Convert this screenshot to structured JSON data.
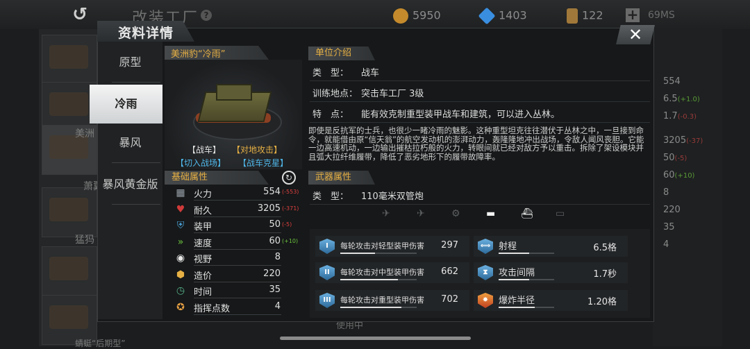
{
  "background": {
    "title": "改装工厂",
    "help": "?",
    "resources": [
      {
        "name": "coins",
        "value": "5950",
        "color": "#c48a2c"
      },
      {
        "name": "diamonds",
        "value": "1403",
        "color": "#3a8ee0"
      },
      {
        "name": "cards",
        "value": "122",
        "color": "#a0783a"
      }
    ],
    "plus": "+",
    "signal": "69MS",
    "left_labels": [
      "美洲",
      "萧翼",
      "猛犸"
    ],
    "bottom_left_label": "蜻蜓“后期型”",
    "stats": [
      {
        "value": "554",
        "delta": ""
      },
      {
        "value": "6.5",
        "delta": "(+1.0)"
      },
      {
        "value": "1.7",
        "delta": "(-0.3)"
      },
      {
        "value": "3205",
        "delta": "(-37)"
      },
      {
        "value": "50",
        "delta": "(-5)"
      },
      {
        "value": "60",
        "delta": "(+10)"
      },
      {
        "value": "8",
        "delta": ""
      },
      {
        "value": "220",
        "delta": ""
      },
      {
        "value": "35",
        "delta": ""
      },
      {
        "value": "4",
        "delta": ""
      }
    ],
    "in_use": "使用中"
  },
  "dialog": {
    "title": "资料详情",
    "close": "✕",
    "variants": [
      "原型",
      "冷雨",
      "暴风",
      "暴风黄金版"
    ],
    "active_variant": 1
  },
  "unit": {
    "name": "美洲豹“冷雨”",
    "tags": [
      {
        "text": "【战车】",
        "color": "#e0e0e0"
      },
      {
        "text": "【对地攻击】",
        "color": "#e6b044"
      },
      {
        "text": "【切入战场】",
        "color": "#4fb6e8"
      },
      {
        "text": "【战车克星】",
        "color": "#4fb6e8"
      }
    ]
  },
  "base_attributes": {
    "header": "基础属性",
    "rows": [
      {
        "icon": "firepower-icon",
        "label": "火力",
        "value": "554",
        "delta": "(-553)",
        "delta_color": "#e04040",
        "icon_color": "#9aa3ab"
      },
      {
        "icon": "heart-icon",
        "label": "耐久",
        "value": "3205",
        "delta": "(-371)",
        "delta_color": "#e04040",
        "icon_color": "#d03a3a"
      },
      {
        "icon": "armor-icon",
        "label": "装甲",
        "value": "50",
        "delta": "(-5)",
        "delta_color": "#e04040",
        "icon_color": "#4aa2d6"
      },
      {
        "icon": "speed-icon",
        "label": "速度",
        "value": "60",
        "delta": "(+10)",
        "delta_color": "#6cc23e",
        "icon_color": "#6cc23e"
      },
      {
        "icon": "vision-icon",
        "label": "视野",
        "value": "8",
        "delta": "",
        "delta_color": "",
        "icon_color": "#e8e8e8"
      },
      {
        "icon": "cost-icon",
        "label": "造价",
        "value": "220",
        "delta": "",
        "delta_color": "",
        "icon_color": "#e6b044"
      },
      {
        "icon": "time-icon",
        "label": "时间",
        "value": "35",
        "delta": "",
        "delta_color": "",
        "icon_color": "#56b08a"
      },
      {
        "icon": "command-icon",
        "label": "指挥点数",
        "value": "4",
        "delta": "",
        "delta_color": "",
        "icon_color": "#e6a044"
      }
    ]
  },
  "unit_intro": {
    "header": "单位介绍",
    "rows": [
      {
        "key": "类　型：",
        "value": "战车"
      },
      {
        "key": "训练地点：",
        "value": "突击车工厂 3级"
      },
      {
        "key": "特　点：",
        "value": "能有效克制重型装甲战车和建筑，可以进入丛林。"
      }
    ],
    "description": "即使是反抗军的士兵，也很少一睹冷雨的魅影。这种重型坦克往往潜伏于丛林之中，一旦接到命令，就能借由原“信天翁”的航空发动机的澎湃动力，轰隆隆地冲出战场，令敌人闻风丧胆。它能一边高速机动，一边输出摧枯拉朽般的火力，转眼间就已经对敌方予以重击。拆除了架设模块并且弧大拉纤维履带，降低了恶劣地形下的履带故障率。"
  },
  "weapon": {
    "header": "武器属性",
    "type_key": "类　型：",
    "type_value": "110毫米双管炮",
    "targets": [
      {
        "icon": "fighter-icon",
        "glyph": "✈",
        "active": false
      },
      {
        "icon": "plane-icon",
        "glyph": "✈",
        "active": false
      },
      {
        "icon": "helicopter-icon",
        "glyph": "⚙",
        "active": false
      },
      {
        "icon": "tank-icon",
        "glyph": "▬",
        "active": true
      },
      {
        "icon": "ship-icon",
        "glyph": "⛴",
        "active": true
      },
      {
        "icon": "submarine-icon",
        "glyph": "▭",
        "active": false
      }
    ],
    "stats_left": [
      {
        "roman": "I",
        "label": "每轮攻击对轻型装甲伤害",
        "value": "297",
        "fill": 0.45
      },
      {
        "roman": "II",
        "label": "每轮攻击对中型装甲伤害",
        "value": "662",
        "fill": 0.75
      },
      {
        "roman": "III",
        "label": "每轮攻击对重型装甲伤害",
        "value": "702",
        "fill": 0.8
      }
    ],
    "stats_right": [
      {
        "icon": "range-icon",
        "label": "射程",
        "value": "6.5格",
        "fill": 0.55
      },
      {
        "icon": "hourglass-icon",
        "label": "攻击间隔",
        "value": "1.7秒",
        "fill": 0.55
      },
      {
        "icon": "explosion-icon",
        "label": "爆炸半径",
        "value": "1.20格",
        "fill": 0.65
      }
    ]
  }
}
